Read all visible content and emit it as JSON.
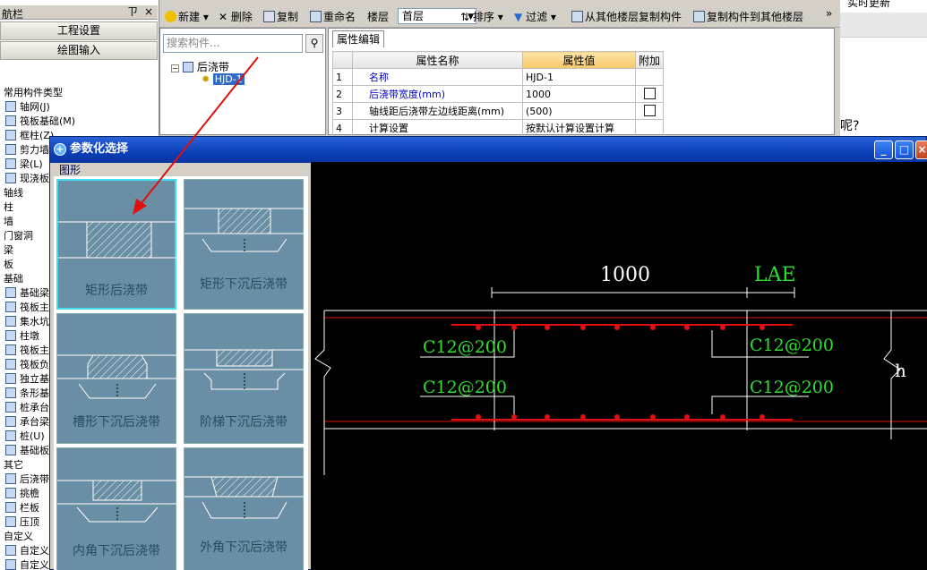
{
  "nav": {
    "title": "航栏",
    "pin": "ㄗ",
    "close": "×",
    "btn_project": "工程设置",
    "btn_drawing": "绘图输入",
    "items": [
      "常用构件类型",
      "轴网(J)",
      "筏板基础(M)",
      "框柱(Z)",
      "剪力墙",
      "梁(L)",
      "现浇板",
      "轴线",
      "柱",
      "墙",
      "门窗洞",
      "梁",
      "板",
      "基础",
      "基础梁",
      "筏板主",
      "集水坑",
      "柱墩",
      "筏板主",
      "筏板负",
      "独立基",
      "条形基",
      "桩承台",
      "承台梁",
      "桩(U)",
      "基础板",
      "其它",
      "后浇带",
      "挑檐",
      "栏板",
      "压顶",
      "自定义",
      "自定义",
      "自定义"
    ]
  },
  "toolbar": {
    "new": "新建",
    "delete": "删除",
    "copy": "复制",
    "rename": "重命名",
    "floor_label": "楼层",
    "floor_value": "首层",
    "sort": "排序",
    "filter": "过滤",
    "copy_from": "从其他楼层复制构件",
    "copy_to": "复制构件到其他楼层",
    "more": "»"
  },
  "right_strip": {
    "text1": "实时更新",
    "text2": "呢?"
  },
  "search": {
    "placeholder": "搜索构件...",
    "tree_root": "后浇带",
    "tree_child": "HJD-1"
  },
  "props": {
    "tab": "属性编辑",
    "headers": [
      "属性名称",
      "属性值",
      "附加"
    ],
    "rows": [
      {
        "n": "1",
        "name": "名称",
        "value": "HJD-1"
      },
      {
        "n": "2",
        "name": "后浇带宽度(mm)",
        "value": "1000"
      },
      {
        "n": "3",
        "name": "轴线距后浇带左边线距离(mm)",
        "value": "(500)"
      },
      {
        "n": "4",
        "name": "计算设置",
        "value": "按默认计算设置计算"
      }
    ]
  },
  "dialog": {
    "title": "参数化选择",
    "shape_label": "图形",
    "shapes": [
      "矩形后浇带",
      "矩形下沉后浇带",
      "槽形下沉后浇带",
      "阶梯下沉后浇带",
      "内角下沉后浇带",
      "外角下沉后浇带"
    ],
    "preview": {
      "width_label": "1000",
      "lae_label": "LAE",
      "rebar_tl": "C12@200",
      "rebar_bl": "C12@200",
      "rebar_tr": "C12@200",
      "rebar_br": "C12@200",
      "h_label": "h"
    }
  },
  "colors": {
    "title_blue": "#0a3fb8",
    "rebar_green": "#2ee02e",
    "rebar_red": "#e01010",
    "tile": "#6a8fa4",
    "tile_sel": "#40e0f0",
    "arrow": "#e01010"
  }
}
